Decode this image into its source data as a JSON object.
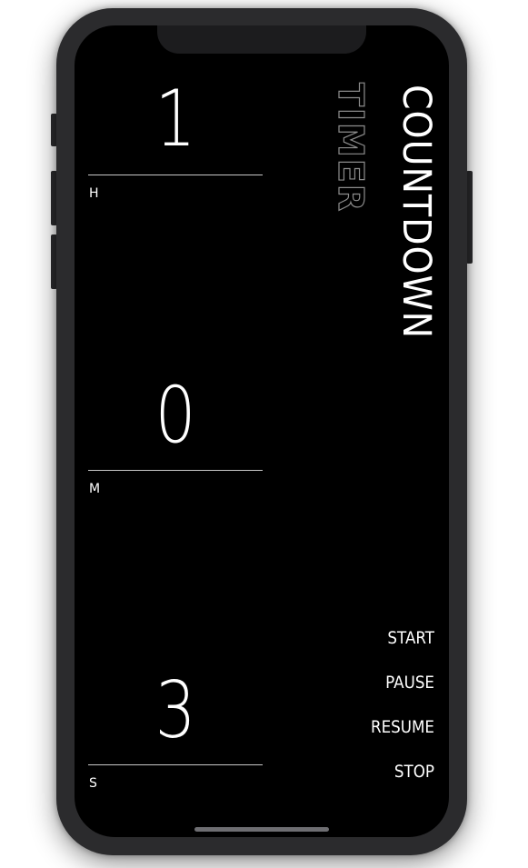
{
  "app": {
    "title": "COUNTDOWN",
    "subtitle": "TIMER"
  },
  "timer": {
    "hours": {
      "value": "1",
      "label": "H"
    },
    "minutes": {
      "value": "0",
      "label": "M"
    },
    "seconds": {
      "value": "3",
      "label": "S"
    }
  },
  "controls": {
    "start_label": "START",
    "pause_label": "PAUSE",
    "resume_label": "RESUME",
    "stop_label": "STOP"
  },
  "colors": {
    "background": "#000000",
    "text": "#ffffff",
    "divider": "#c8c8c8",
    "subtitle_outline": "#8c8c8c",
    "device_frame": "#2b2b2d"
  }
}
